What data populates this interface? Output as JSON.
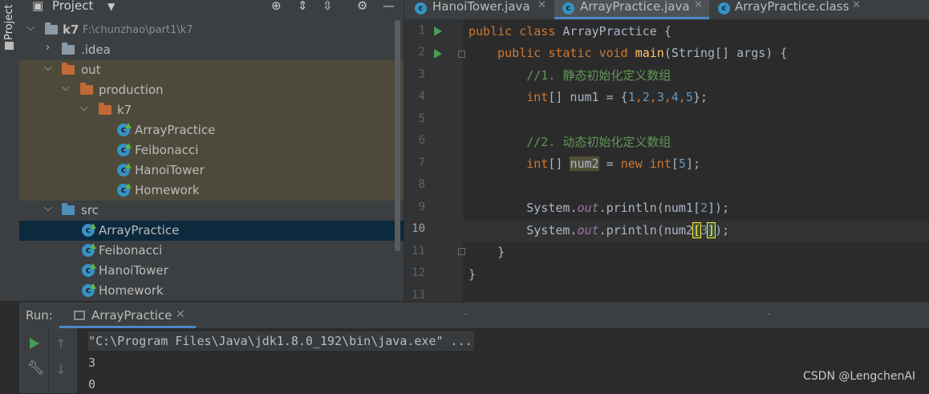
{
  "tool_window_stripe": {
    "label": "Project"
  },
  "project_panel": {
    "title": "Project",
    "tree": [
      {
        "label": "k7",
        "path": "F:\\chunzhao\\part1\\k7",
        "type": "module",
        "expanded": true,
        "level": 0
      },
      {
        "label": ".idea",
        "type": "folder",
        "expanded": false,
        "level": 1
      },
      {
        "label": "out",
        "type": "folder-excluded",
        "expanded": true,
        "level": 1
      },
      {
        "label": "production",
        "type": "folder-excluded",
        "expanded": true,
        "level": 2
      },
      {
        "label": "k7",
        "type": "folder-excluded",
        "expanded": true,
        "level": 3
      },
      {
        "label": "ArrayPractice",
        "type": "class",
        "level": 4
      },
      {
        "label": "Feibonacci",
        "type": "class",
        "level": 4
      },
      {
        "label": "HanoiTower",
        "type": "class",
        "level": 4
      },
      {
        "label": "Homework",
        "type": "class",
        "level": 4
      },
      {
        "label": "src",
        "type": "source-folder",
        "expanded": true,
        "level": 1
      },
      {
        "label": "ArrayPractice",
        "type": "class",
        "level": 2,
        "selected": true
      },
      {
        "label": "Feibonacci",
        "type": "class",
        "level": 2
      },
      {
        "label": "HanoiTower",
        "type": "class",
        "level": 2
      },
      {
        "label": "Homework",
        "type": "class",
        "level": 2
      }
    ]
  },
  "editor": {
    "tabs": [
      {
        "label": "HanoiTower.java",
        "active": false
      },
      {
        "label": "ArrayPractice.java",
        "active": true
      },
      {
        "label": "ArrayPractice.class",
        "active": false
      }
    ],
    "line_numbers": [
      "1",
      "2",
      "3",
      "4",
      "5",
      "6",
      "7",
      "8",
      "9",
      "10",
      "11",
      "12",
      "13"
    ],
    "current_line": "10",
    "code": {
      "l1": {
        "kw1": "public",
        "kw2": "class",
        "name": "ArrayPractice",
        "rest": " {"
      },
      "l2": {
        "kw1": "public",
        "kw2": "static",
        "kw3": "void",
        "fn": "main",
        "rest": "(String[] args) {"
      },
      "l3": {
        "comment": "//1. 静态初始化定义数组"
      },
      "l4": {
        "kw": "int",
        "a": "[] num1 = {",
        "n1": "1",
        "c1": ",",
        "n2": "2",
        "c2": ",",
        "n3": "3",
        "c3": ",",
        "n4": "4",
        "c4": ",",
        "n5": "5",
        "end": "};"
      },
      "l6": {
        "comment": "//2. 动态初始化定义数组"
      },
      "l7": {
        "kw": "int",
        "a": "[] ",
        "var": "num2",
        "b": " = ",
        "kw2": "new",
        "sp": " ",
        "kw3": "int",
        "c": "[",
        "n": "5",
        "d": "];"
      },
      "l9": {
        "a": "System.",
        "field": "out",
        "b": ".println(num1[",
        "n": "2",
        "c": "]);"
      },
      "l10": {
        "a": "System.",
        "field": "out",
        "b": ".println(num2",
        "lb": "[",
        "n": "3",
        "rb": "]",
        "c": ");"
      },
      "l11": {
        "text": "}"
      },
      "l12": {
        "text": "}"
      }
    }
  },
  "run_panel": {
    "label": "Run:",
    "tab": "ArrayPractice",
    "output": [
      "\"C:\\Program Files\\Java\\jdk1.8.0_192\\bin\\java.exe\" ...",
      "3",
      "0"
    ]
  },
  "watermark": "CSDN @LengchenAI",
  "colors": {
    "background": "#2b2b2b",
    "panel": "#3c3f41",
    "keyword": "#cc7832",
    "function": "#ffc66d",
    "comment": "#629755",
    "number": "#6897bb",
    "static_field": "#9876aa",
    "selection": "#0d293e",
    "excluded_folder": "#c16a38",
    "accent": "#4a88c7"
  }
}
